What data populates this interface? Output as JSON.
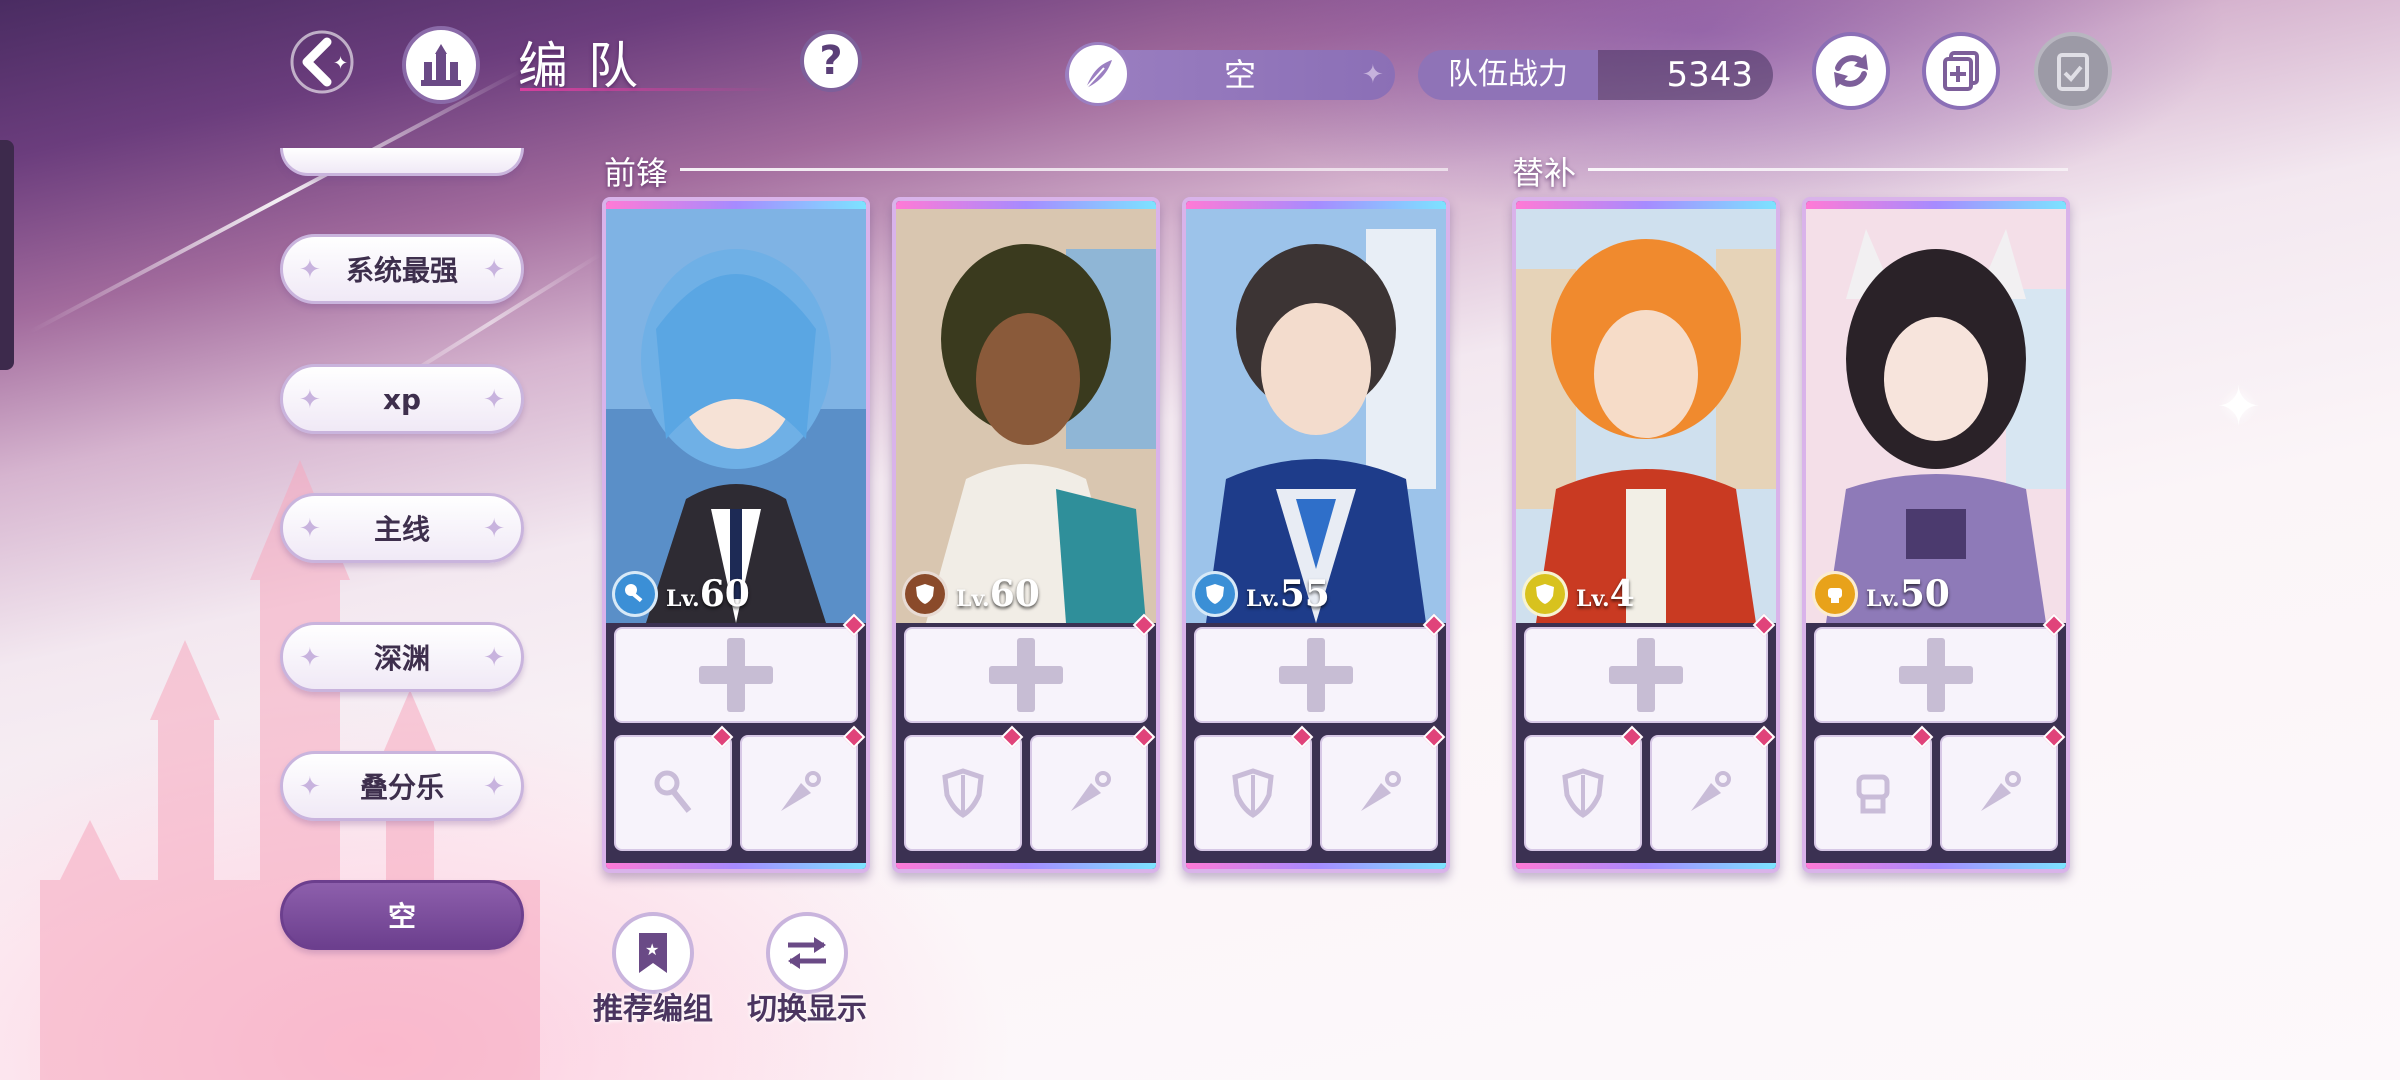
{
  "header": {
    "title": "编队",
    "help_label": "?",
    "team_name": "空",
    "power_label": "队伍战力",
    "power_value": "5343"
  },
  "sidebar": {
    "items": [
      {
        "label": "系统最强",
        "active": false
      },
      {
        "label": "xp",
        "active": false
      },
      {
        "label": "主线",
        "active": false
      },
      {
        "label": "深渊",
        "active": false
      },
      {
        "label": "叠分乐",
        "active": false
      },
      {
        "label": "空",
        "active": true
      }
    ]
  },
  "sections": {
    "front": "前锋",
    "bench": "替补"
  },
  "cards": [
    {
      "lv_prefix": "Lv.",
      "level": "60",
      "class_icon": "key-icon",
      "class_color": "#3b8fd6",
      "sub_left_icon": "key-icon",
      "sub_right_icon": "kunai-icon"
    },
    {
      "lv_prefix": "Lv.",
      "level": "60",
      "class_icon": "shield-icon",
      "class_color": "#8a4a2a",
      "sub_left_icon": "shield-icon",
      "sub_right_icon": "kunai-icon"
    },
    {
      "lv_prefix": "Lv.",
      "level": "55",
      "class_icon": "shield-icon",
      "class_color": "#3b8fd6",
      "sub_left_icon": "shield-icon",
      "sub_right_icon": "kunai-icon"
    },
    {
      "lv_prefix": "Lv.",
      "level": "4",
      "class_icon": "shield-icon",
      "class_color": "#d8c21e",
      "sub_left_icon": "shield-icon",
      "sub_right_icon": "kunai-icon"
    },
    {
      "lv_prefix": "Lv.",
      "level": "50",
      "class_icon": "fist-icon",
      "class_color": "#e8a21a",
      "sub_left_icon": "fist-icon",
      "sub_right_icon": "kunai-icon"
    }
  ],
  "bottom": {
    "recommend_label": "推荐编组",
    "switch_label": "切换显示"
  }
}
